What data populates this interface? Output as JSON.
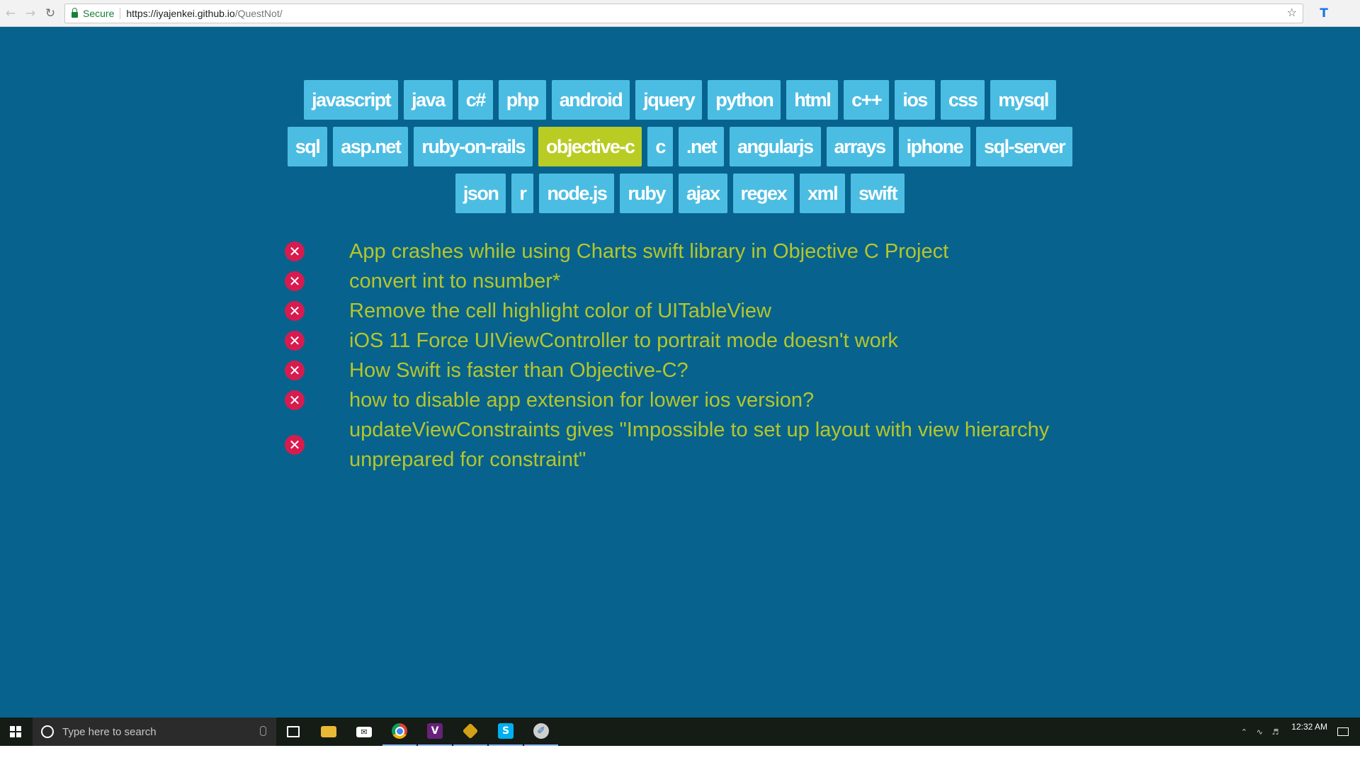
{
  "browser": {
    "secure_label": "Secure",
    "url_host": "https://iyajenkei.github.io",
    "url_path": "/QuestNot/"
  },
  "tags": [
    {
      "label": "javascript",
      "active": false
    },
    {
      "label": "java",
      "active": false
    },
    {
      "label": "c#",
      "active": false
    },
    {
      "label": "php",
      "active": false
    },
    {
      "label": "android",
      "active": false
    },
    {
      "label": "jquery",
      "active": false
    },
    {
      "label": "python",
      "active": false
    },
    {
      "label": "html",
      "active": false
    },
    {
      "label": "c++",
      "active": false
    },
    {
      "label": "ios",
      "active": false
    },
    {
      "label": "css",
      "active": false
    },
    {
      "label": "mysql",
      "active": false
    },
    {
      "label": "sql",
      "active": false
    },
    {
      "label": "asp.net",
      "active": false
    },
    {
      "label": "ruby-on-rails",
      "active": false
    },
    {
      "label": "objective-c",
      "active": true
    },
    {
      "label": "c",
      "active": false
    },
    {
      "label": ".net",
      "active": false
    },
    {
      "label": "angularjs",
      "active": false
    },
    {
      "label": "arrays",
      "active": false
    },
    {
      "label": "iphone",
      "active": false
    },
    {
      "label": "sql-server",
      "active": false
    },
    {
      "label": "json",
      "active": false
    },
    {
      "label": "r",
      "active": false
    },
    {
      "label": "node.js",
      "active": false
    },
    {
      "label": "ruby",
      "active": false
    },
    {
      "label": "ajax",
      "active": false
    },
    {
      "label": "regex",
      "active": false
    },
    {
      "label": "xml",
      "active": false
    },
    {
      "label": "swift",
      "active": false
    }
  ],
  "questions": [
    {
      "text": "App crashes while using Charts swift library in Objective C Project"
    },
    {
      "text": "convert int to nsumber*"
    },
    {
      "text": "Remove the cell highlight color of UITableView"
    },
    {
      "text": "iOS 11 Force UIViewController to portrait mode doesn't work"
    },
    {
      "text": "How Swift is faster than Objective-C?"
    },
    {
      "text": "how to disable app extension for lower ios version?"
    },
    {
      "text": "updateViewConstraints gives \"Impossible to set up layout with view hierarchy unprepared for constraint\""
    }
  ],
  "taskbar": {
    "search_placeholder": "Type here to search",
    "clock": "12:32 AM"
  },
  "colors": {
    "page_background": "#07638d",
    "tag_background": "#4cbde2",
    "tag_active_background": "#b9cc24",
    "question_text": "#b6c62a",
    "remove_icon": "#d81b4f"
  },
  "icons": {
    "nav": [
      "back-arrow-icon",
      "forward-arrow-icon",
      "reload-icon"
    ],
    "omnibox": [
      "lock-icon",
      "bookmark-star-icon"
    ],
    "extension": "extension-icon",
    "question_row": "remove-circle-icon",
    "taskbar_apps": [
      "task-view-icon",
      "file-explorer-icon",
      "mail-icon",
      "chrome-icon",
      "visual-studio-icon",
      "git-icon",
      "skype-icon",
      "paint-icon"
    ]
  }
}
